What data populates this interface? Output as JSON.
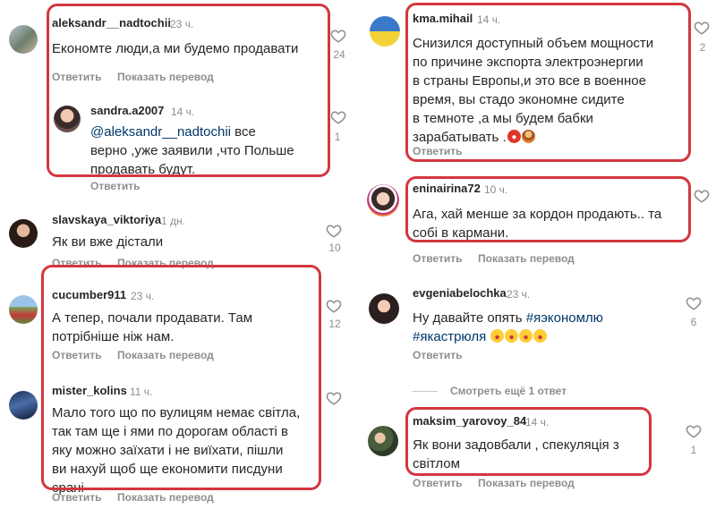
{
  "actions": {
    "reply": "Ответить",
    "translate": "Показать перевод"
  },
  "left": [
    {
      "user": "aleksandr__nadtochii",
      "time": "23 ч.",
      "text": "Економте люди,а ми будемо продавати",
      "likes": "24"
    },
    {
      "user": "sandra.a2007",
      "time": "14 ч.",
      "mention": "@aleksandr__nadtochii",
      "text": " все\nверно ,уже заявили ,что Польше\nпродавать будут.",
      "likes": "1"
    },
    {
      "user": "slavskaya_viktoriya",
      "time": "1 дн.",
      "text": "Як ви вже дістали",
      "likes": "10"
    },
    {
      "user": "cucumber911",
      "time": "23 ч.",
      "text": "А тепер, почали продавати. Там\nпотрібніше ніж нам.",
      "likes": "12"
    },
    {
      "user": "mister_kolins",
      "time": "11 ч.",
      "text": "Мало того що по вулицям немає світла,\nтак там ще і ями по дорогам області в\nяку можно заїхати і не виїхати, пішли\nви нахуй щоб ще економити писдуни\nсрані",
      "likes": ""
    }
  ],
  "right": [
    {
      "user": "kma.mihail",
      "time": "14 ч.",
      "text": "Снизился доступный объем мощности\nпо причине экспорта электроэнергии\nв страны Европы,и это все в военное\nвремя, вы стадо экономне сидите\nв темноте ,а мы будем бабки\nзарабатывать .",
      "likes": "2"
    },
    {
      "user": "eninairina72",
      "time": "10 ч.",
      "text": "Ага, хай менше за кордон продають.. та\nсобі в кармани.",
      "likes": ""
    },
    {
      "user": "evgeniabelochka",
      "time": "23 ч.",
      "text": "Ну давайте опять ",
      "tags": "#яэкономлю\n#якастрюля",
      "likes": "6"
    },
    {
      "user": "maksim_yarovoy_84",
      "time": "14 ч.",
      "text": "Як вони задовбали , спекуляція з\nсвітлом",
      "likes": "1"
    }
  ],
  "more_replies": "Смотреть ещё 1 ответ",
  "colors": {
    "highlight": "#d3373f",
    "muted": "#8e8e8e",
    "link": "#00376b"
  },
  "icons": [
    "heart-outline-icon",
    "angry-emoji-icon",
    "person-emoji-icon",
    "laughing-emoji-icon"
  ]
}
